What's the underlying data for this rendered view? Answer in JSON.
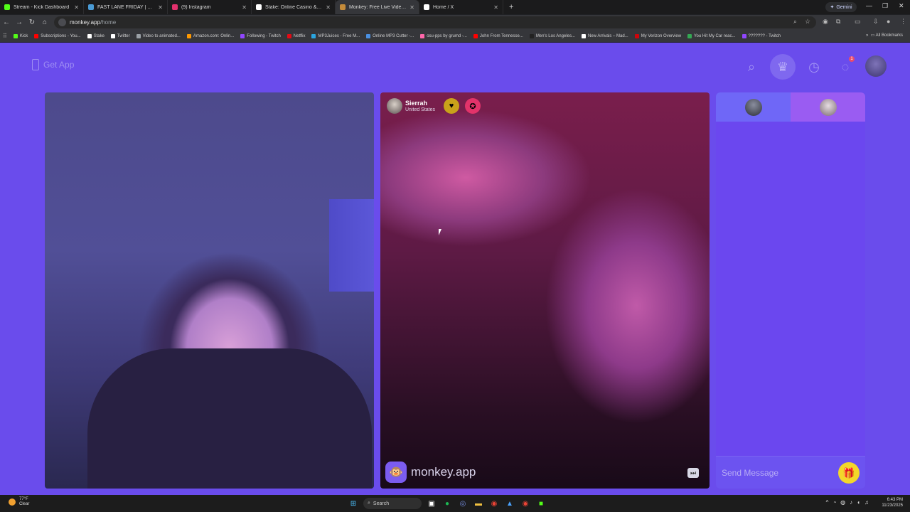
{
  "browser": {
    "tabs": [
      {
        "label": "Stream - Kick Dashboard",
        "color": "#53fc18"
      },
      {
        "label": "FAST LANE FRIDAY | HOMESTE...",
        "color": "#4a9bd6"
      },
      {
        "label": "(9) Instagram",
        "color": "#e1306c"
      },
      {
        "label": "Stake: Online Casino & Sports ...",
        "color": "#ffffff"
      },
      {
        "label": "Monkey: Free Live Video Ch...",
        "color": "#c48b3a",
        "active": true
      },
      {
        "label": "Home / X",
        "color": "#ffffff"
      }
    ],
    "gemini_label": "Gemini",
    "url_host": "monkey.app",
    "url_path": "/home",
    "bookmarks": [
      {
        "label": "Kick",
        "color": "#53fc18"
      },
      {
        "label": "Subscriptions - You...",
        "color": "#ff0000"
      },
      {
        "label": "Stake",
        "color": "#ffffff"
      },
      {
        "label": "Twitter",
        "color": "#ffffff"
      },
      {
        "label": "Video to animated...",
        "color": "#9aa0a6"
      },
      {
        "label": "Amazon.com: Onlin...",
        "color": "#ff9900"
      },
      {
        "label": "Following - Twitch",
        "color": "#9146ff"
      },
      {
        "label": "Netflix",
        "color": "#e50914"
      },
      {
        "label": "MP3Juices - Free M...",
        "color": "#2aa5e0"
      },
      {
        "label": "Online MP3 Cutter -...",
        "color": "#4a90e2"
      },
      {
        "label": "osu-pps by grumd -...",
        "color": "#ff66aa"
      },
      {
        "label": "John From Tennesse...",
        "color": "#ff0000"
      },
      {
        "label": "Men's Los Angeles...",
        "color": "#222222"
      },
      {
        "label": "New Arrivals – Mad...",
        "color": "#ffffff"
      },
      {
        "label": "My Verizon Overview",
        "color": "#cd040b"
      },
      {
        "label": "You Hit My Car reac...",
        "color": "#34a853"
      },
      {
        "label": "??????? - Twitch",
        "color": "#9146ff"
      }
    ],
    "all_bookmarks_label": "All Bookmarks"
  },
  "app": {
    "get_app_label": "Get App",
    "notification_count": "1",
    "remote_user": {
      "name": "Sierrah",
      "country": "United States"
    },
    "brand_label": "monkey.app",
    "message_placeholder": "Send Message",
    "colors": {
      "background": "#6a4cec",
      "accent": "#f3d72a"
    }
  },
  "taskbar": {
    "temperature": "77°F",
    "condition": "Clear",
    "search_label": "Search",
    "time": "6:43 PM",
    "date": "11/23/2025"
  }
}
